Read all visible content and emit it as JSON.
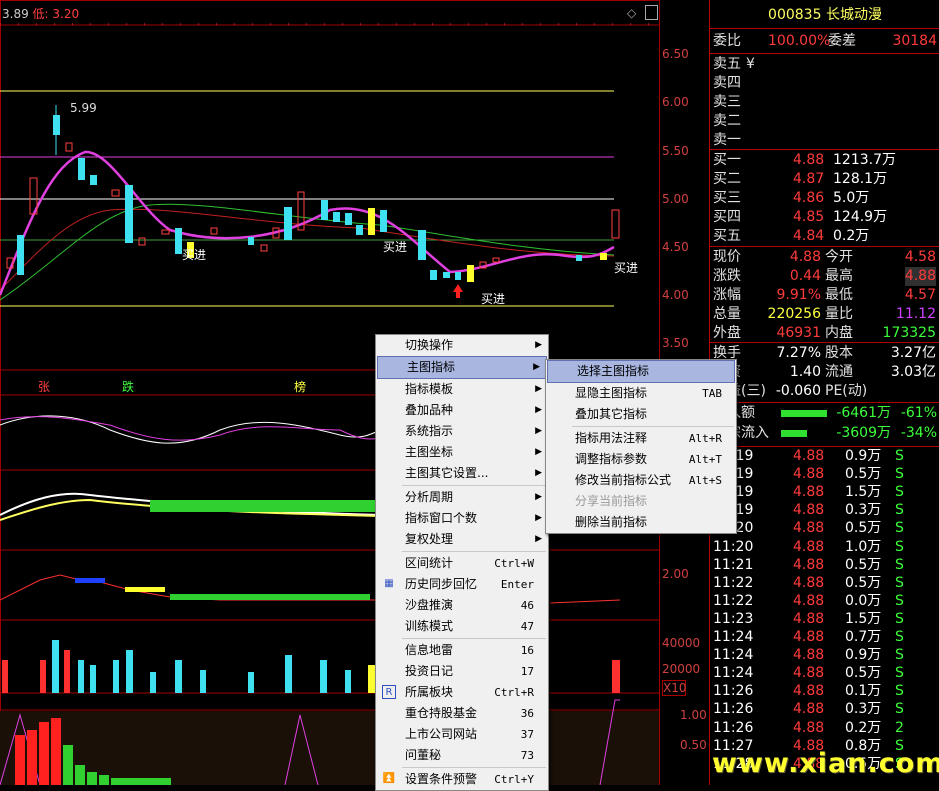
{
  "header": {
    "last": "3.89",
    "low_label": "低: 3.20"
  },
  "chart": {
    "price_axis": [
      "6.50",
      "6.00",
      "5.50",
      "5.00",
      "4.50",
      "4.00",
      "3.50"
    ],
    "osc_axis": [
      "2.00"
    ],
    "vol_axis": [
      "40000",
      "20000"
    ],
    "vol_unit": "X10",
    "bottom_axis": [
      "1.00",
      "0.50"
    ],
    "annotations": {
      "peak": "5.99",
      "buy1": "买进",
      "buy2": "买进",
      "buy3": "买进",
      "buy4": "买进"
    },
    "signal_row": [
      "张",
      "跌",
      "榜"
    ]
  },
  "quote": {
    "title": "000835 长城动漫",
    "weibi_label": "委比",
    "weibi_value": "100.00%",
    "weicha_label": "委差",
    "weicha_value": "30184",
    "sell": [
      {
        "label": "卖五",
        "extra": "¥"
      },
      {
        "label": "卖四",
        "extra": ""
      },
      {
        "label": "卖三",
        "extra": ""
      },
      {
        "label": "卖二",
        "extra": ""
      },
      {
        "label": "卖一",
        "extra": ""
      }
    ],
    "buy": [
      {
        "label": "买一",
        "price": "4.88",
        "vol": "1213.7万"
      },
      {
        "label": "买二",
        "price": "4.87",
        "vol": "128.1万"
      },
      {
        "label": "买三",
        "price": "4.86",
        "vol": "5.0万"
      },
      {
        "label": "买四",
        "price": "4.85",
        "vol": "124.9万"
      },
      {
        "label": "买五",
        "price": "4.84",
        "vol": "0.2万"
      }
    ],
    "stats": [
      {
        "l1": "现价",
        "v1": "4.88",
        "c1": "red",
        "l2": "今开",
        "v2": "4.58",
        "c2": "red"
      },
      {
        "l1": "涨跌",
        "v1": "0.44",
        "c1": "red",
        "l2": "最高",
        "v2": "4.88",
        "c2": "red"
      },
      {
        "l1": "涨幅",
        "v1": "9.91%",
        "c1": "red",
        "l2": "最低",
        "v2": "4.57",
        "c2": "red"
      },
      {
        "l1": "总量",
        "v1": "220256",
        "c1": "yel",
        "l2": "量比",
        "v2": "11.12",
        "c2": "mag"
      },
      {
        "l1": "外盘",
        "v1": "46931",
        "c1": "red",
        "l2": "内盘",
        "v2": "173325",
        "c2": "grn"
      }
    ],
    "stats2": [
      {
        "l1": "换手",
        "v1": "7.27%",
        "l2": "股本",
        "v2": "3.27亿"
      },
      {
        "l1": "净资",
        "v1": "1.40",
        "l2": "流通",
        "v2": "3.03亿"
      },
      {
        "l1": "收益(三)",
        "v1": "-0.060",
        "l2": "PE(动)",
        "v2": ""
      }
    ],
    "flow": [
      {
        "label": "流入额",
        "value": "-6461万",
        "pct": "-61%",
        "bar": 0.61
      },
      {
        "label": "大宗流入",
        "value": "-3609万",
        "pct": "-34%",
        "bar": 0.34
      }
    ],
    "ticks": [
      {
        "t": "11:19",
        "p": "4.88",
        "v": "0.9万",
        "s": "S"
      },
      {
        "t": "11:19",
        "p": "4.88",
        "v": "0.5万",
        "s": "S"
      },
      {
        "t": "11:19",
        "p": "4.88",
        "v": "1.5万",
        "s": "S"
      },
      {
        "t": "11:19",
        "p": "4.88",
        "v": "0.3万",
        "s": "S"
      },
      {
        "t": "11:20",
        "p": "4.88",
        "v": "0.5万",
        "s": "S"
      },
      {
        "t": "11:20",
        "p": "4.88",
        "v": "1.0万",
        "s": "S"
      },
      {
        "t": "11:21",
        "p": "4.88",
        "v": "0.5万",
        "s": "S"
      },
      {
        "t": "11:22",
        "p": "4.88",
        "v": "0.5万",
        "s": "S"
      },
      {
        "t": "11:22",
        "p": "4.88",
        "v": "0.0万",
        "s": "S"
      },
      {
        "t": "11:23",
        "p": "4.88",
        "v": "1.5万",
        "s": "S"
      },
      {
        "t": "11:24",
        "p": "4.88",
        "v": "0.7万",
        "s": "S"
      },
      {
        "t": "11:24",
        "p": "4.88",
        "v": "0.9万",
        "s": "S"
      },
      {
        "t": "11:24",
        "p": "4.88",
        "v": "0.5万",
        "s": "S"
      },
      {
        "t": "11:26",
        "p": "4.88",
        "v": "0.1万",
        "s": "S"
      },
      {
        "t": "11:26",
        "p": "4.88",
        "v": "0.3万",
        "s": "S"
      },
      {
        "t": "11:26",
        "p": "4.88",
        "v": "0.2万",
        "s": "2"
      },
      {
        "t": "11:27",
        "p": "4.88",
        "v": "0.8万",
        "s": "S"
      },
      {
        "t": "11:28",
        "p": "4.88",
        "v": "0.5万",
        "s": "S"
      }
    ]
  },
  "menu": {
    "items": [
      {
        "label": "切换操作",
        "sc": "",
        "arrow": true
      },
      {
        "label": "主图指标",
        "sc": "",
        "arrow": true,
        "hl": true
      },
      {
        "label": "指标模板",
        "sc": "",
        "arrow": true
      },
      {
        "label": "叠加品种",
        "sc": "",
        "arrow": true
      },
      {
        "label": "系统指示",
        "sc": "",
        "arrow": true
      },
      {
        "label": "主图坐标",
        "sc": "",
        "arrow": true
      },
      {
        "label": "主图其它设置...",
        "sc": "",
        "arrow": true
      },
      {
        "sep": true
      },
      {
        "label": "分析周期",
        "sc": "",
        "arrow": true
      },
      {
        "label": "指标窗口个数",
        "sc": "",
        "arrow": true
      },
      {
        "label": "复权处理",
        "sc": "",
        "arrow": true
      },
      {
        "sep": true
      },
      {
        "label": "区间统计",
        "sc": "Ctrl+W"
      },
      {
        "label": "历史同步回忆",
        "sc": "Enter",
        "icon": "calendar-icon"
      },
      {
        "label": "沙盘推演",
        "sc": "46"
      },
      {
        "label": "训练模式",
        "sc": "47"
      },
      {
        "sep": true
      },
      {
        "label": "信息地雷",
        "sc": "16"
      },
      {
        "label": "投资日记",
        "sc": "17"
      },
      {
        "label": "所属板块",
        "sc": "Ctrl+R",
        "icon": "r-icon"
      },
      {
        "label": "重仓持股基金",
        "sc": "36"
      },
      {
        "label": "上市公司网站",
        "sc": "37"
      },
      {
        "label": "问董秘",
        "sc": "73"
      },
      {
        "sep": true
      },
      {
        "label": "设置条件预警",
        "sc": "Ctrl+Y",
        "icon": "alert-icon"
      }
    ],
    "submenu": [
      {
        "label": "选择主图指标",
        "sc": "",
        "hl": true
      },
      {
        "label": "显隐主图指标",
        "sc": "TAB"
      },
      {
        "label": "叠加其它指标",
        "sc": ""
      },
      {
        "sep": true
      },
      {
        "label": "指标用法注释",
        "sc": "Alt+R"
      },
      {
        "label": "调整指标参数",
        "sc": "Alt+T"
      },
      {
        "label": "修改当前指标公式",
        "sc": "Alt+S"
      },
      {
        "label": "分享当前指标",
        "sc": "",
        "dis": true
      },
      {
        "label": "删除当前指标",
        "sc": ""
      }
    ]
  },
  "watermark": "www.xian.com"
}
